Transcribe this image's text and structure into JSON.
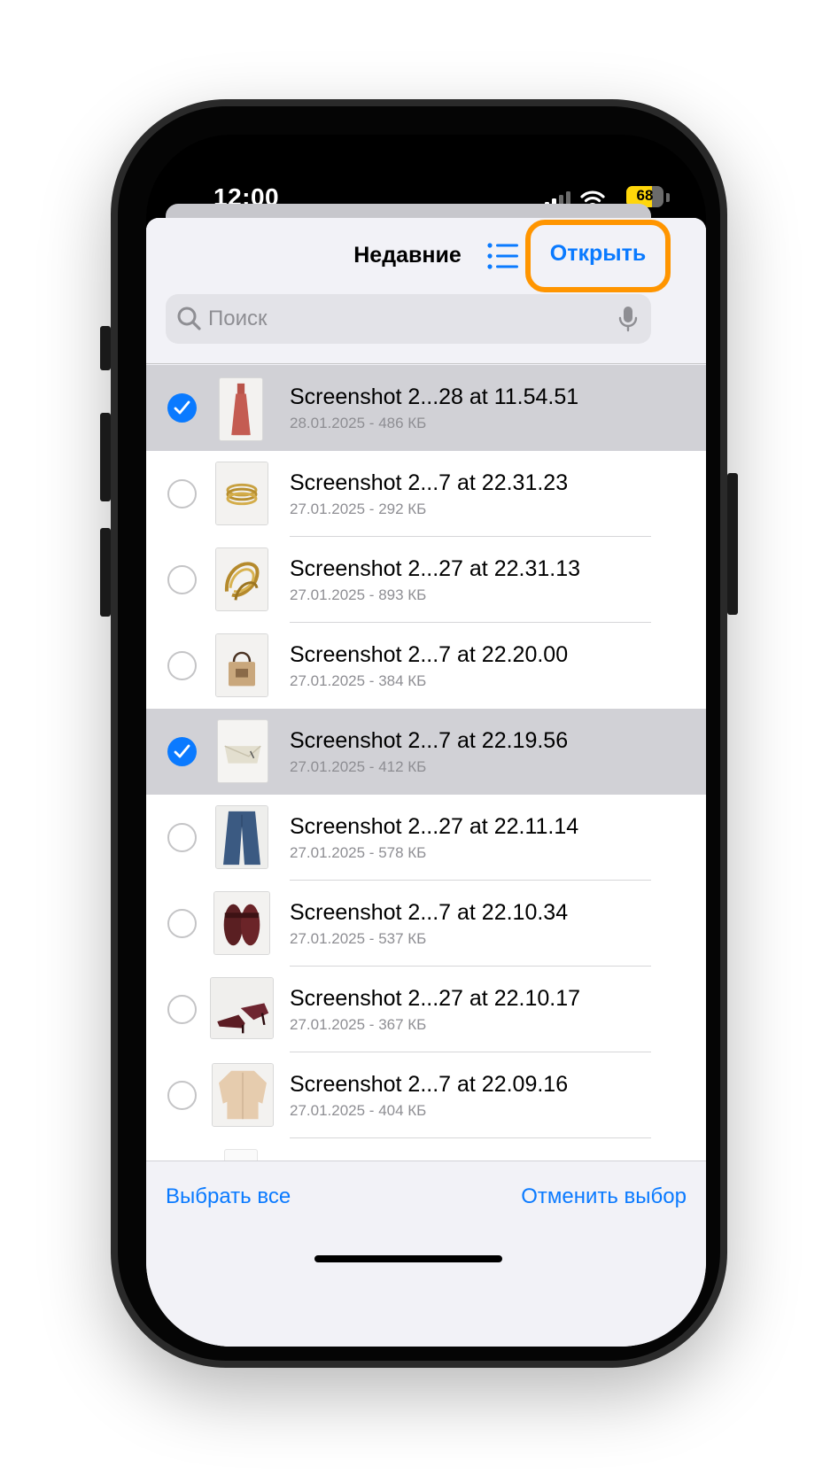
{
  "status_bar": {
    "time": "12:00",
    "battery": "68",
    "battery_level": 0.68,
    "icons": [
      "cellular-signal-icon",
      "wifi-icon",
      "battery-icon"
    ]
  },
  "header": {
    "title": "Недавние",
    "open_label": "Открыть",
    "list_view_icon": "list-icon"
  },
  "search": {
    "placeholder": "Поиск",
    "value": "",
    "icons": [
      "search-icon",
      "microphone-icon"
    ]
  },
  "files": [
    {
      "name": "Screenshot 2...28 at 11.54.51",
      "meta": "28.01.2025 - 486 КБ",
      "selected": true,
      "thumbnail": "red-dress"
    },
    {
      "name": "Screenshot 2...7 at 22.31.23",
      "meta": "27.01.2025 - 292 КБ",
      "selected": false,
      "thumbnail": "gold-bangles"
    },
    {
      "name": "Screenshot 2...27 at 22.31.13",
      "meta": "27.01.2025 - 893 КБ",
      "selected": false,
      "thumbnail": "gold-rings"
    },
    {
      "name": "Screenshot 2...7 at 22.20.00",
      "meta": "27.01.2025 - 384 КБ",
      "selected": false,
      "thumbnail": "straw-bag"
    },
    {
      "name": "Screenshot 2...7 at 22.19.56",
      "meta": "27.01.2025 - 412 КБ",
      "selected": true,
      "thumbnail": "cream-clutch"
    },
    {
      "name": "Screenshot 2...27 at 22.11.14",
      "meta": "27.01.2025 - 578 КБ",
      "selected": false,
      "thumbnail": "jeans"
    },
    {
      "name": "Screenshot 2...7 at 22.10.34",
      "meta": "27.01.2025 - 537 КБ",
      "selected": false,
      "thumbnail": "burgundy-sandals"
    },
    {
      "name": "Screenshot 2...27 at 22.10.17",
      "meta": "27.01.2025 - 367 КБ",
      "selected": false,
      "thumbnail": "heeled-sandals"
    },
    {
      "name": "Screenshot 2...7 at 22.09.16",
      "meta": "27.01.2025 - 404 КБ",
      "selected": false,
      "thumbnail": "beige-shirt"
    }
  ],
  "toolbar": {
    "select_all": "Выбрать все",
    "deselect": "Отменить выбор"
  },
  "colors": {
    "accent": "#0a7aff",
    "highlight": "#ff9500",
    "selected_row": "#d1d1d6"
  }
}
